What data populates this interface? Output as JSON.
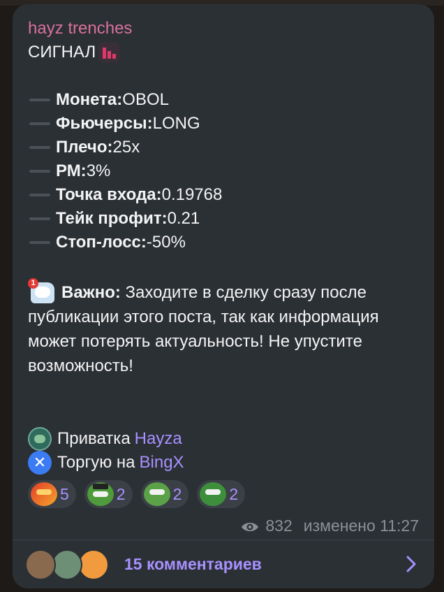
{
  "post": {
    "author": "hayz trenches",
    "title": "СИГНАЛ",
    "fields": [
      {
        "label": "Монета:",
        "value": " OBOL"
      },
      {
        "label": "Фьючерсы:",
        "value": " LONG"
      },
      {
        "label": "Плечо:",
        "value": " 25x"
      },
      {
        "label": "РМ:",
        "value": " 3%"
      },
      {
        "label": "Точка входа:",
        "value": " 0.19768"
      },
      {
        "label": "Тейк профит:",
        "value": " 0.21"
      },
      {
        "label": "Стоп-лосс:",
        "value": " -50%"
      }
    ],
    "notice_label": "Важно:",
    "notice_text": " Заходите в сделку сразу после публикации этого поста, так как информация может потерять актуальность! Не упустите возможность!",
    "links": [
      {
        "text": "Приватка",
        "accent": "Hayza",
        "icon": "private-channel-icon"
      },
      {
        "text": "Торгую на",
        "accent": "BingX",
        "icon": "bingx-icon"
      }
    ]
  },
  "reactions": [
    {
      "icon": "fire-meme-emoji",
      "count": "5"
    },
    {
      "icon": "pepe-hat-emoji",
      "count": "2"
    },
    {
      "icon": "pepe-money-emoji",
      "count": "2"
    },
    {
      "icon": "pepe-cash-emoji",
      "count": "2"
    }
  ],
  "meta": {
    "views": "832",
    "edited": "изменено 11:27"
  },
  "comments": {
    "label": "15 комментариев"
  },
  "colors": {
    "accent": "#a891ff",
    "author": "#d9719a",
    "bubble": "#2b3035"
  }
}
